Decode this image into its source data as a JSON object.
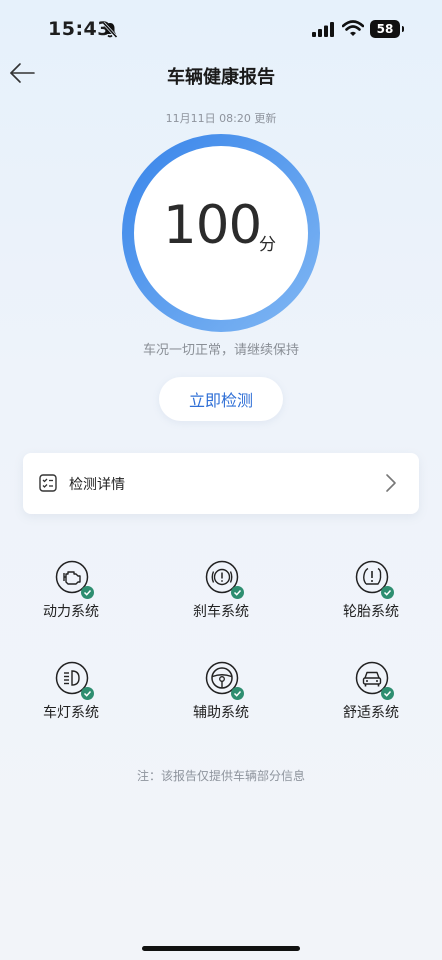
{
  "status_bar": {
    "time": "15:43",
    "battery": "58"
  },
  "header": {
    "title": "车辆健康报告"
  },
  "report": {
    "update_time": "11月11日 08:20 更新",
    "score": "100",
    "score_unit": "分",
    "status_text": "车况一切正常，请继续保持"
  },
  "actions": {
    "detect_label": "立即检测"
  },
  "detail": {
    "label": "检测详情"
  },
  "systems": [
    {
      "label": "动力系统",
      "icon": "engine-icon",
      "status": "ok"
    },
    {
      "label": "刹车系统",
      "icon": "brake-icon",
      "status": "ok"
    },
    {
      "label": "轮胎系统",
      "icon": "tire-pressure-icon",
      "status": "ok"
    },
    {
      "label": "车灯系统",
      "icon": "headlight-icon",
      "status": "ok"
    },
    {
      "label": "辅助系统",
      "icon": "steering-wheel-icon",
      "status": "ok"
    },
    {
      "label": "舒适系统",
      "icon": "car-front-icon",
      "status": "ok"
    }
  ],
  "footer": {
    "note": "注：该报告仅提供车辆部分信息"
  },
  "colors": {
    "accent": "#2f6fd6",
    "ring_start": "#3a86ea",
    "ring_end": "#7fb6f3",
    "check": "#2e8e70"
  }
}
